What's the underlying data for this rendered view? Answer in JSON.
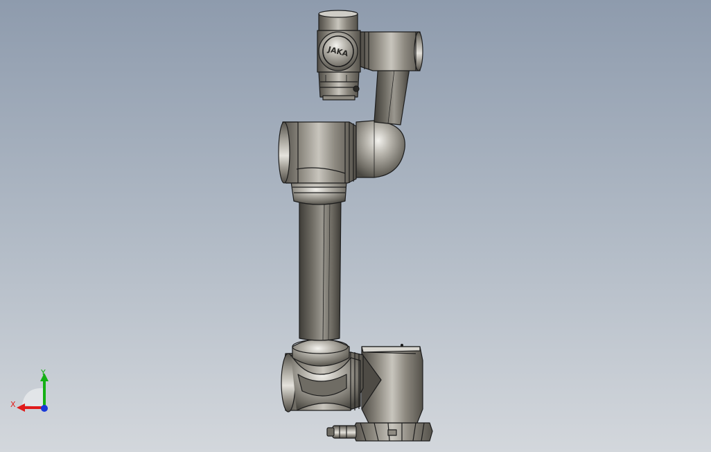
{
  "colors": {
    "background_top": "#8e9bad",
    "background_bottom": "#d3d7dc",
    "metal_dark": "#5f5c55",
    "metal_mid": "#8f8b82",
    "metal_light": "#e8e6e1",
    "edge": "#1c1c1c",
    "axis_x": "#e01b1b",
    "axis_y": "#14b014",
    "axis_z": "#1838d8"
  },
  "model": {
    "name": "robot-arm-model",
    "logo_text": "JAKA"
  },
  "triad": {
    "x_label": "X",
    "y_label": "Y"
  }
}
